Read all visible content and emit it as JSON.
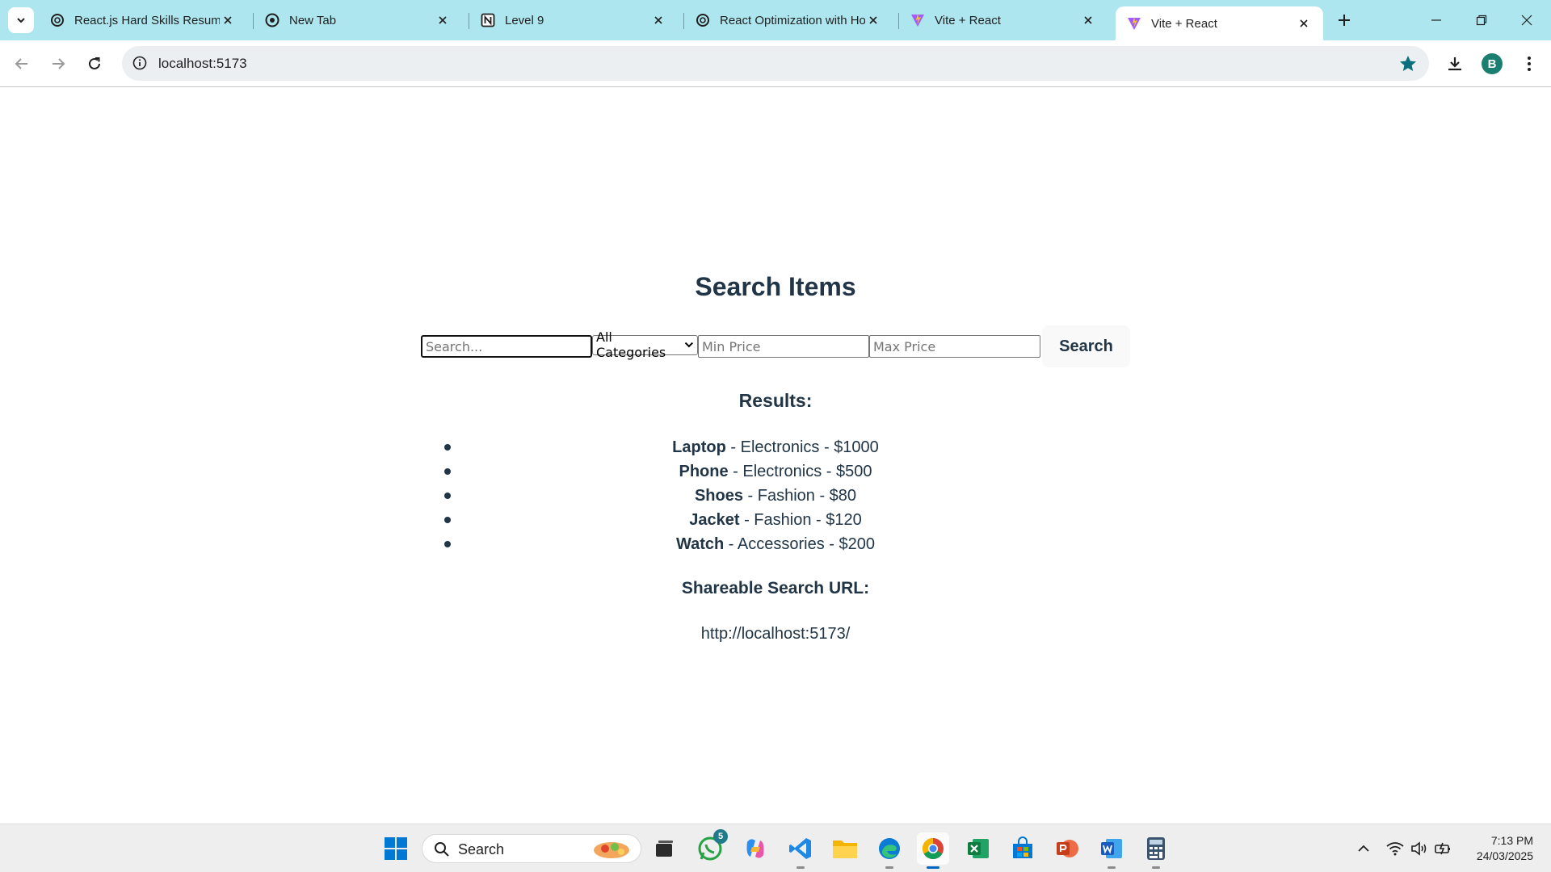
{
  "browser": {
    "tabs": [
      {
        "title": "React.js Hard Skills Resume",
        "favicon": "openai-icon"
      },
      {
        "title": "New Tab",
        "favicon": "chrome-icon"
      },
      {
        "title": "Level 9",
        "favicon": "notion-icon"
      },
      {
        "title": "React Optimization with Hooks",
        "favicon": "openai-icon"
      },
      {
        "title": "Vite + React",
        "favicon": "vite-icon"
      },
      {
        "title": "Vite + React",
        "favicon": "vite-icon",
        "active": true
      }
    ],
    "url": "localhost:5173",
    "profile_initial": "B",
    "colors": {
      "titlebar": "#aee6f0",
      "accent": "#0b6e7d",
      "profile": "#1a7f70"
    }
  },
  "page": {
    "title": "Search Items",
    "search": {
      "placeholder": "Search...",
      "value": ""
    },
    "category": {
      "selected": "All Categories"
    },
    "min_price": {
      "placeholder": "Min Price"
    },
    "max_price": {
      "placeholder": "Max Price"
    },
    "search_button": "Search",
    "results_heading": "Results:",
    "results": [
      {
        "name": "Laptop",
        "rest": " - Electronics - $1000"
      },
      {
        "name": "Phone",
        "rest": " - Electronics - $500"
      },
      {
        "name": "Shoes",
        "rest": " - Fashion - $80"
      },
      {
        "name": "Jacket",
        "rest": " - Fashion - $120"
      },
      {
        "name": "Watch",
        "rest": " - Accessories - $200"
      }
    ],
    "share_heading": "Shareable Search URL:",
    "share_url": "http://localhost:5173/"
  },
  "taskbar": {
    "search_label": "Search",
    "whatsapp_badge": "5",
    "time": "7:13 PM",
    "date": "24/03/2025"
  }
}
